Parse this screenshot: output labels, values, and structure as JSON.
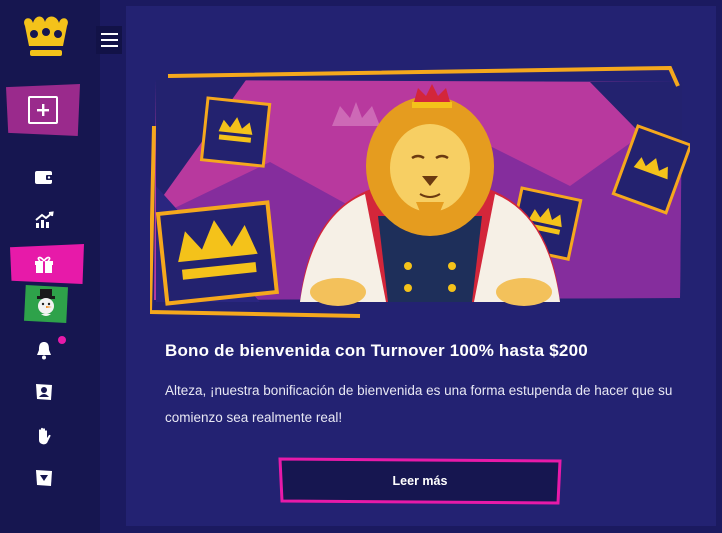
{
  "sidebar": {
    "logo_icon": "crown-logo-icon",
    "deposit_icon": "plus-box-icon",
    "items": [
      {
        "icon": "wallet-icon"
      },
      {
        "icon": "chart-up-icon"
      },
      {
        "icon": "gift-icon",
        "active": true
      },
      {
        "icon": "snowman-avatar-icon"
      },
      {
        "icon": "bell-icon",
        "badge": true
      },
      {
        "icon": "user-card-icon"
      },
      {
        "icon": "hand-stop-icon"
      },
      {
        "icon": "dropdown-box-icon"
      }
    ],
    "menu_icon": "hamburger-icon"
  },
  "promo": {
    "title": "Bono de bienvenida con Turnover 100% hasta $200",
    "description": "Alteza, ¡nuestra bonificación de bienvenida es una forma estupenda de hacer que su comienzo sea realmente real!",
    "cta_label": "Leer más"
  },
  "colors": {
    "background": "#1b1a60",
    "sidebar": "#161650",
    "card": "#232272",
    "accent_pink": "#e71aa9",
    "accent_gold": "#f5a81d",
    "banner_magenta": "#b8399e"
  }
}
